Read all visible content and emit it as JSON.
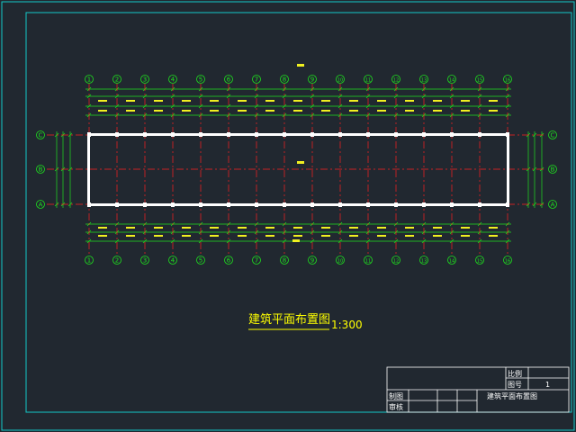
{
  "drawing": {
    "title": "建筑平面布置图",
    "scale": "1:300",
    "column_axes": [
      "1",
      "2",
      "3",
      "4",
      "5",
      "6",
      "7",
      "8",
      "9",
      "10",
      "11",
      "12",
      "13",
      "14",
      "15",
      "16"
    ],
    "row_axes": [
      "C",
      "B",
      "A"
    ]
  },
  "title_block": {
    "label_scale": "比例",
    "label_sheet_no": "图号",
    "sheet_no": "1",
    "label_drawn": "制图",
    "label_checked": "审核",
    "drawing_name": "建筑平面布置图"
  },
  "colors": {
    "background": "#212830",
    "frame": "#12c8c8",
    "axis_line": "#ff2020",
    "dimension": "#1ee01e",
    "wall": "#ffffff",
    "text_yellow": "#f0f020",
    "text_title": "#ffff00"
  }
}
